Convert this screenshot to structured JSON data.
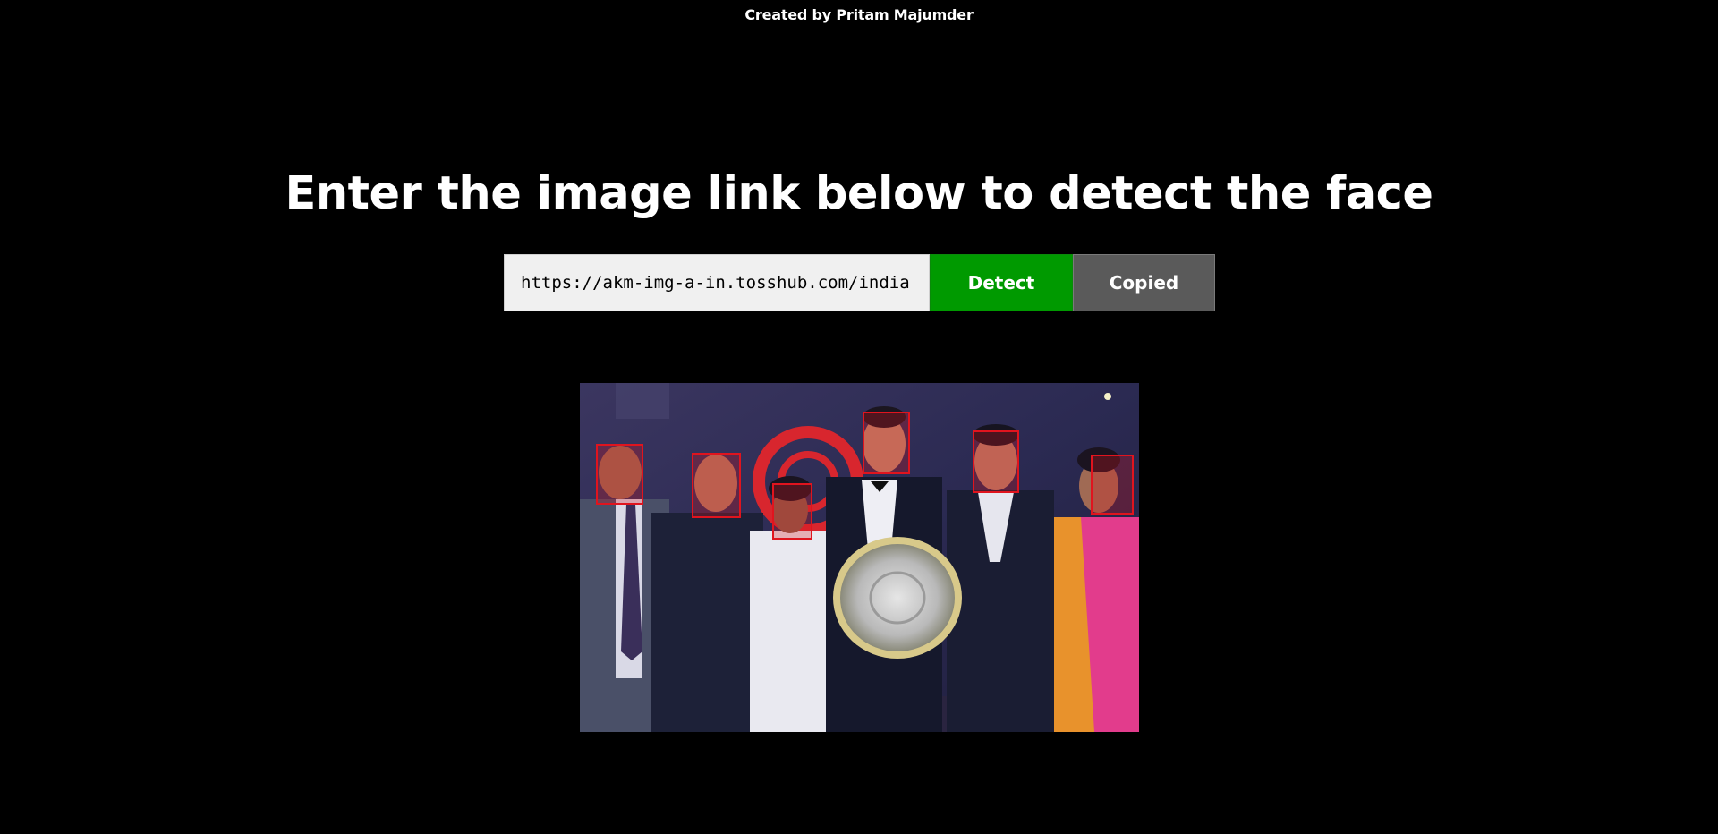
{
  "header": {
    "credit": "Created by Pritam Majumder"
  },
  "main": {
    "heading": "Enter the image link below to detect the face",
    "url_input": {
      "value": "https://akm-img-a-in.tosshub.com/india"
    },
    "detect_button": "Detect",
    "copy_button": "Copied"
  },
  "result": {
    "faces_detected": 6,
    "box_color": "#e0141e"
  },
  "colors": {
    "background": "#000000",
    "detect_green": "#009a00",
    "copied_gray": "#5a5a5a"
  }
}
